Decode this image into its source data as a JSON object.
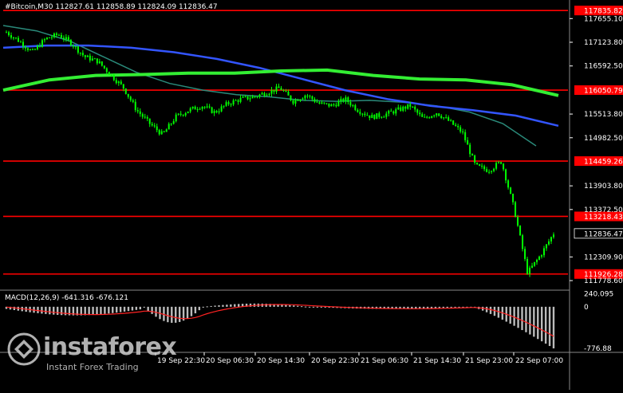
{
  "header": {
    "symbol": "#Bitcoin,M30",
    "ohlc": "112827.61 112858.89 112824.09 112836.47"
  },
  "macd_header": {
    "label": "MACD(12,26,9) -641.316 -676.121"
  },
  "logo": {
    "name": "instaforex",
    "tagline": "Instant Forex Trading"
  },
  "colors": {
    "background": "#000000",
    "candle": "#00ff00",
    "ma_fast": "#2a8a7a",
    "ma_mid": "#3355ff",
    "ma_slow": "#33ee33",
    "level_line": "#ff0000",
    "macd_hist": "#bbbbbb",
    "macd_signal": "#ff2222",
    "axis_text": "#ffffff"
  },
  "chart_data": {
    "type": "candlestick",
    "instrument": "#Bitcoin",
    "timeframe": "M30",
    "price_axis_ticks": [
      117655.1,
      117123.8,
      116592.5,
      115513.8,
      114982.5,
      113903.8,
      113372.5,
      112309.9,
      111778.6
    ],
    "y_range": [
      111600,
      118000
    ],
    "x_tick_labels": [
      "19 Sep 22:30",
      "20 Sep 06:30",
      "20 Sep 14:30",
      "20 Sep 22:30",
      "21 Sep 06:30",
      "21 Sep 14:30",
      "21 Sep 23:00",
      "22 Sep 07:00"
    ],
    "levels": [
      {
        "value": 117835.82,
        "label": "117835.82"
      },
      {
        "value": 116050.79,
        "label": "116050.79"
      },
      {
        "value": 114459.26,
        "label": "114459.26"
      },
      {
        "value": 113218.43,
        "label": "113218.43"
      },
      {
        "value": 111926.28,
        "label": "111926.28"
      }
    ],
    "current_price": {
      "value": 112836.47,
      "label": "112836.47"
    },
    "close_path": [
      117350,
      117150,
      116900,
      117200,
      117300,
      117100,
      116800,
      116700,
      116400,
      116100,
      115600,
      115300,
      115050,
      115450,
      115600,
      115700,
      115550,
      115750,
      115850,
      115900,
      116000,
      116100,
      115800,
      115950,
      115750,
      115700,
      115850,
      115600,
      115450,
      115500,
      115600,
      115700,
      115400,
      115550,
      115350,
      115100,
      114350,
      114250,
      114450,
      113350,
      111950,
      112350,
      112836
    ],
    "moving_averages": [
      {
        "color": "#2a8a7a",
        "values": [
          117500,
          117380,
          117150,
          116800,
          116450,
          116200,
          116050,
          115950,
          115900,
          115820,
          115800,
          115820,
          115780,
          115700,
          115560,
          115300,
          114800
        ]
      },
      {
        "color": "#3355ff",
        "values": [
          117000,
          117050,
          117050,
          117000,
          116900,
          116750,
          116550,
          116300,
          116050,
          115850,
          115700,
          115600,
          115480,
          115250
        ]
      },
      {
        "color": "#33ee33",
        "values": [
          116050,
          116280,
          116380,
          116400,
          116430,
          116430,
          116480,
          116500,
          116380,
          116300,
          116280,
          116170,
          115930
        ]
      }
    ],
    "macd": {
      "params": "12,26,9",
      "main": -641.316,
      "signal": -676.121,
      "ticks": [
        240.095,
        0,
        -776.88
      ],
      "y_range": [
        -820,
        280
      ]
    }
  }
}
